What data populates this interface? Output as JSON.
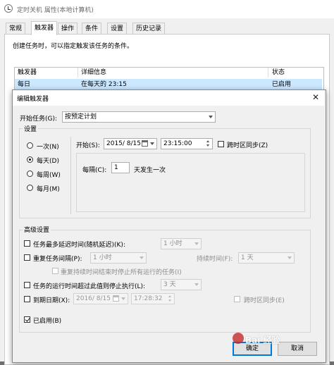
{
  "outer": {
    "title": "定时关机 属性(本地计算机)",
    "tabs": [
      "常规",
      "触发器",
      "操作",
      "条件",
      "设置",
      "历史记录"
    ],
    "active_tab": "触发器",
    "description": "创建任务时，可以指定触发该任务的条件。",
    "table": {
      "headers": [
        "触发器",
        "详细信息",
        "状态"
      ],
      "rows": [
        {
          "trigger": "每日",
          "detail": "在每天的 23:15",
          "status": "已启用"
        }
      ]
    }
  },
  "dialog": {
    "title": "编辑触发器",
    "close_glyph": "✕",
    "begin_task_label": "开始任务(G):",
    "begin_task_value": "按预定计划",
    "settings_label": "设置",
    "schedule_options": [
      {
        "label": "一次(N)",
        "selected": false
      },
      {
        "label": "每天(D)",
        "selected": true
      },
      {
        "label": "每周(W)",
        "selected": false
      },
      {
        "label": "每月(M)",
        "selected": false
      }
    ],
    "start_label": "开始(S):",
    "start_date": "2015/  8/15",
    "start_time": "23:15:00",
    "sync_timezone_label": "跨时区同步(Z)",
    "recur_label": "每隔(C):",
    "recur_value": "1",
    "recur_unit": "天发生一次",
    "advanced_label": "高级设置",
    "delay_label": "任务最多延迟时间(随机延迟)(K):",
    "delay_value": "1 小时",
    "repeat_label": "重复任务间隔(P):",
    "repeat_value": "1 小时",
    "duration_label": "持续时间(F):",
    "duration_value": "1 天",
    "stop_all_label": "重复持续时间结束时停止所有运行的任务(I)",
    "stop_if_longer_label": "任务的运行时间超过此值则停止执行(L):",
    "stop_if_longer_value": "3 天",
    "expire_label": "到期日期(X):",
    "expire_date": "2016/  8/15",
    "expire_time": "17:28:32",
    "expire_sync_label": "跨时区同步(E)",
    "enabled_label": "已启用(B)",
    "ok_label": "确定",
    "cancel_label": "取消"
  },
  "watermark": "Bai 经验"
}
